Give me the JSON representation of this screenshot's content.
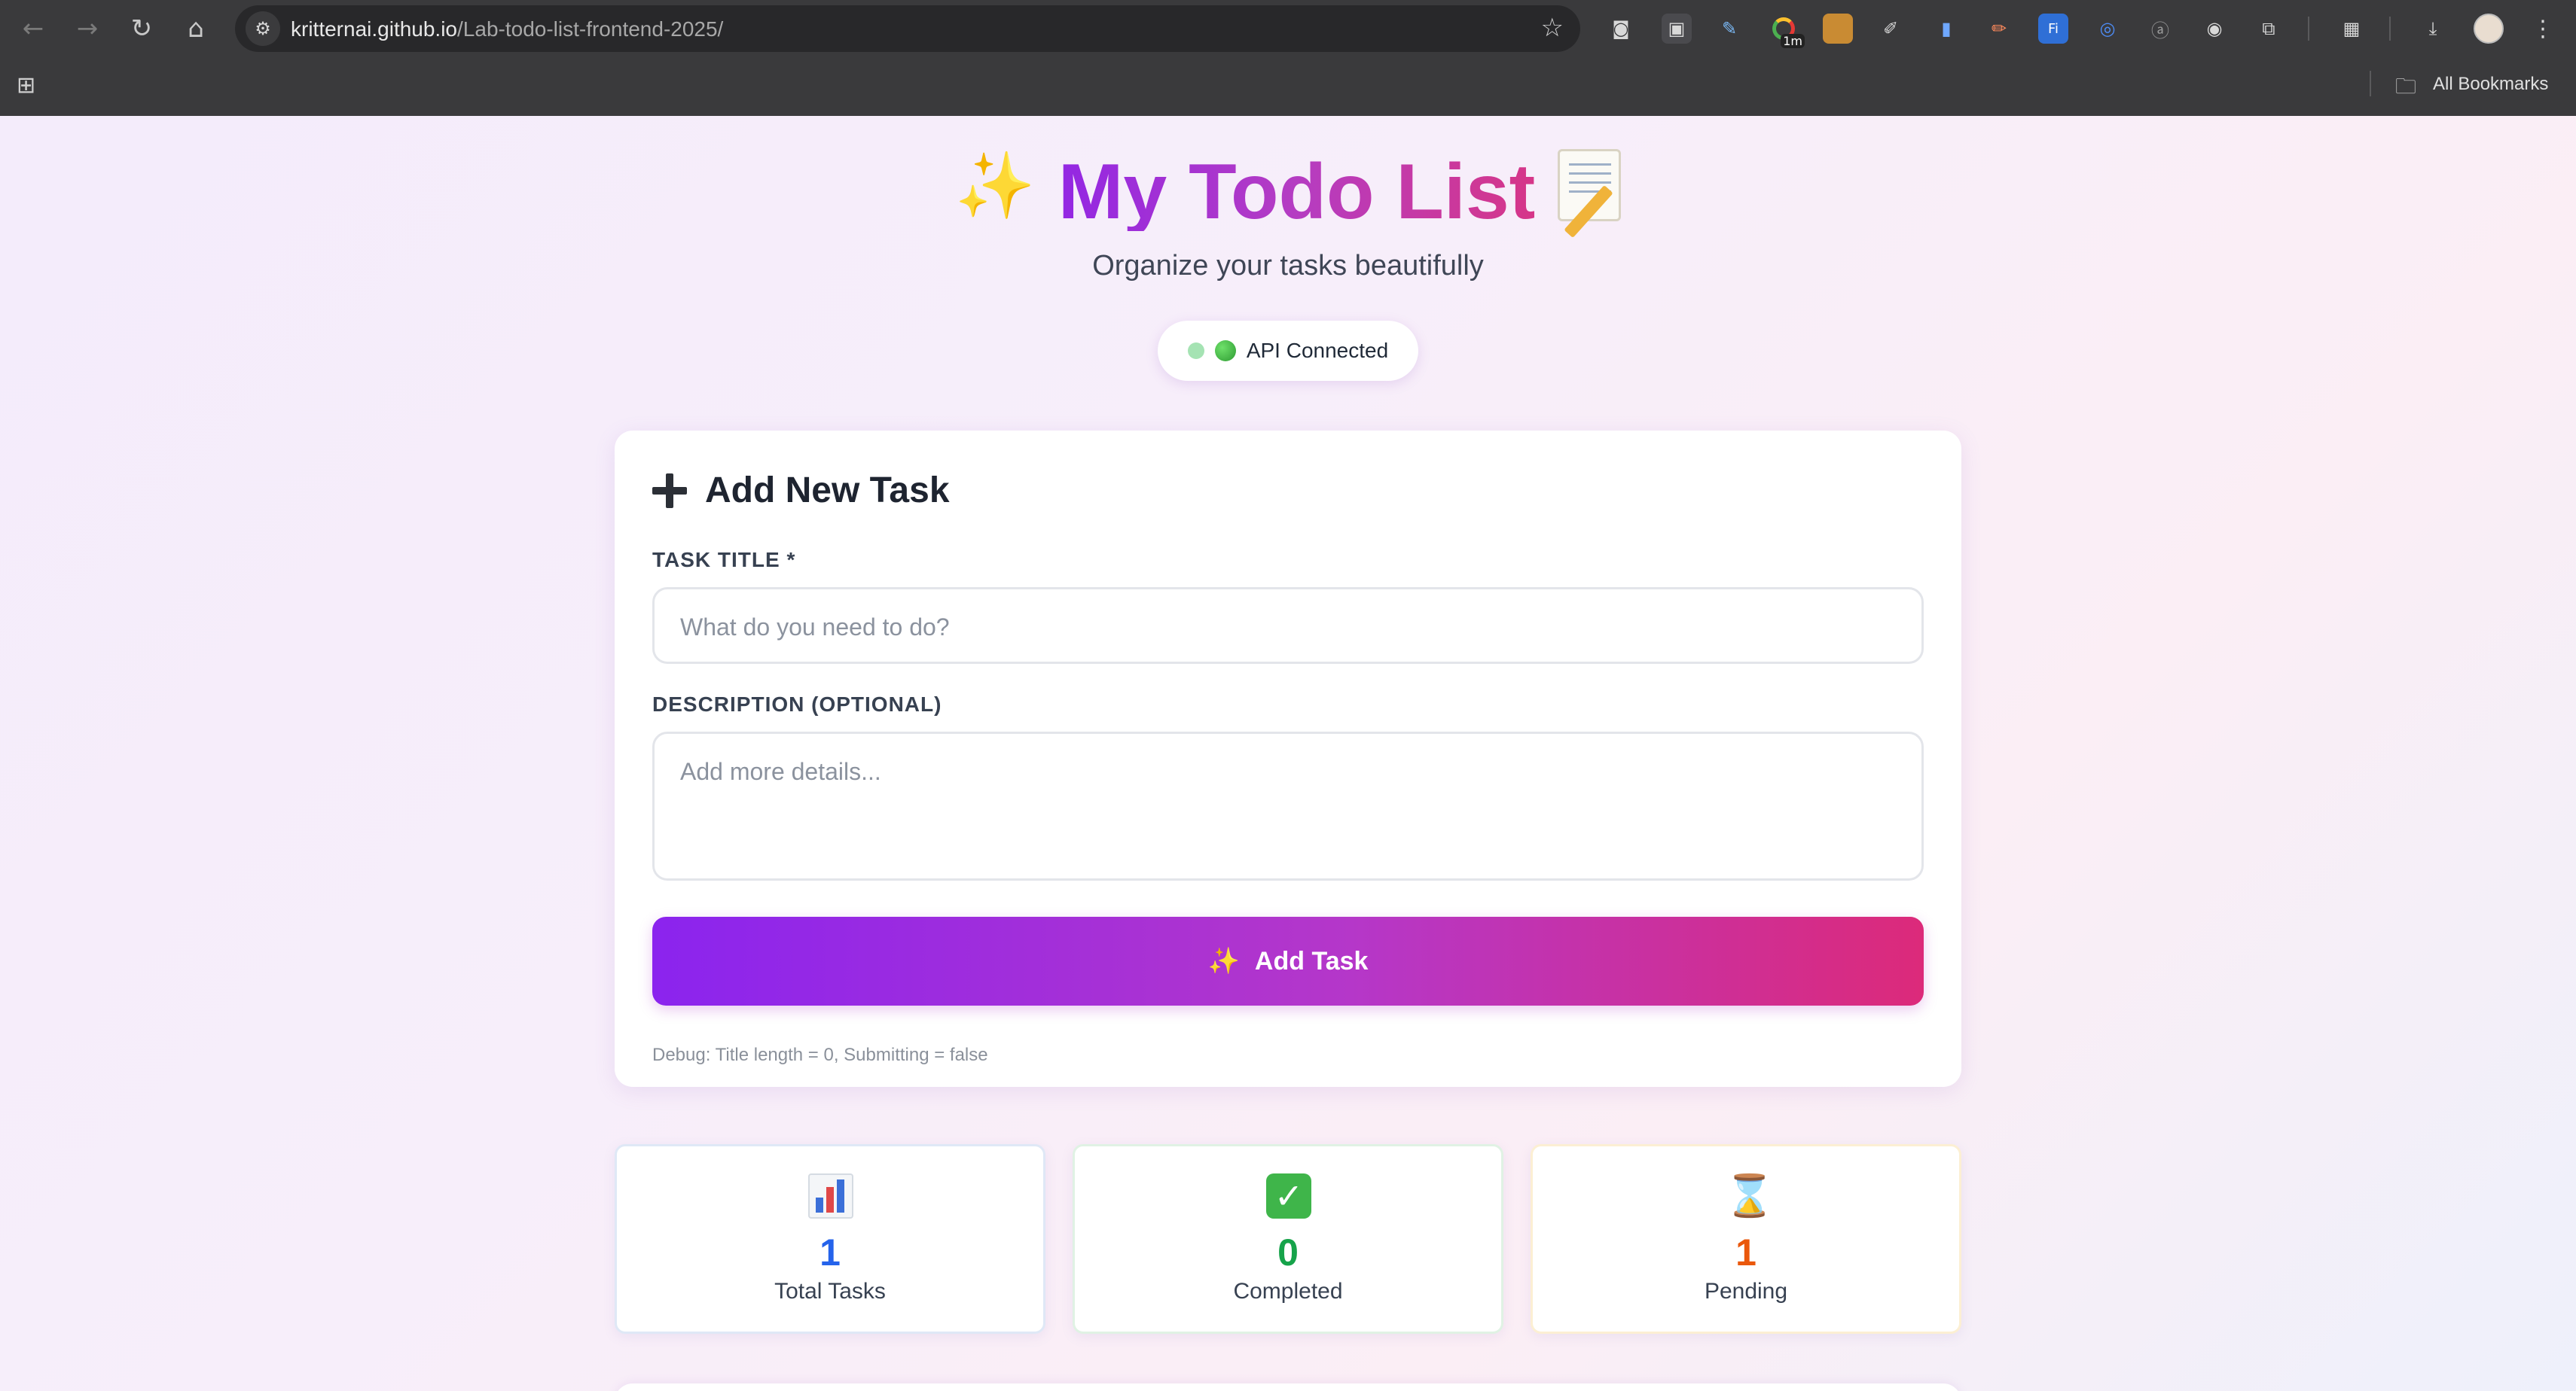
{
  "browser": {
    "url_host": "kritternai.github.io",
    "url_path": "/Lab-todo-list-frontend-2025/",
    "all_bookmarks_label": "All Bookmarks",
    "extension_badge": "1m"
  },
  "app": {
    "title": "My Todo List",
    "subtitle": "Organize your tasks beautifully",
    "api_status": "API Connected",
    "colors": {
      "accent_start": "#8b24ee",
      "accent_end": "#dc2a7a",
      "total": "#2563eb",
      "completed": "#16a34a",
      "pending": "#ea580c"
    }
  },
  "form": {
    "heading": "Add New Task",
    "title_label": "TASK TITLE *",
    "title_placeholder": "What do you need to do?",
    "description_label": "DESCRIPTION (OPTIONAL)",
    "description_placeholder": "Add more details...",
    "submit_label": "Add Task",
    "debug_text": "Debug: Title length = 0, Submitting = false"
  },
  "stats": [
    {
      "icon": "bar-chart-icon",
      "value": "1",
      "label": "Total Tasks"
    },
    {
      "icon": "check-mark-icon",
      "value": "0",
      "label": "Completed"
    },
    {
      "icon": "hourglass-icon",
      "value": "1",
      "label": "Pending"
    }
  ]
}
